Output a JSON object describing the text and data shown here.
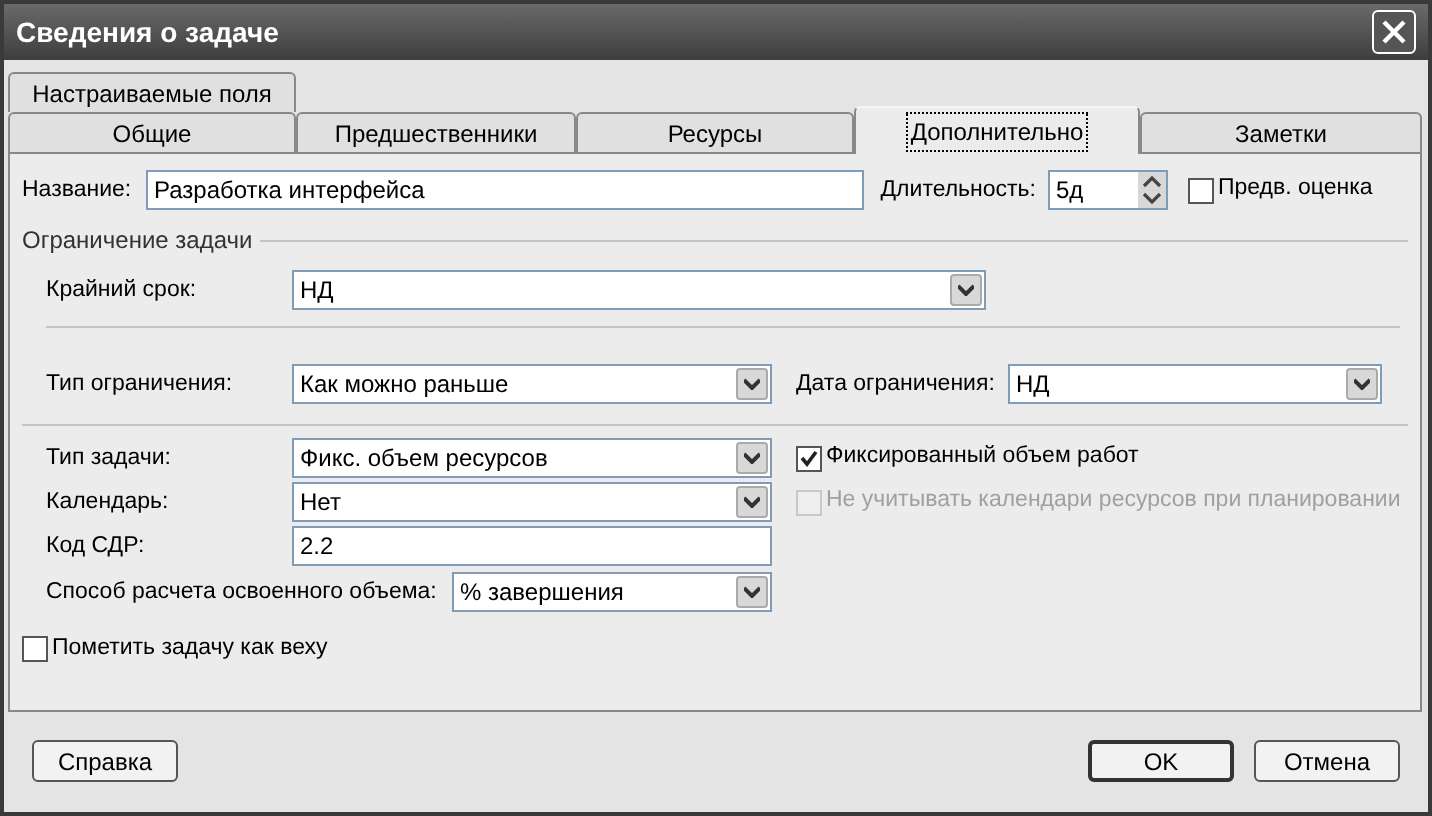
{
  "window": {
    "title": "Сведения о задаче"
  },
  "tab_rows": [
    [
      {
        "label": "Настраиваемые поля",
        "selected": false
      }
    ],
    [
      {
        "label": "Общие",
        "selected": false
      },
      {
        "label": "Предшественники",
        "selected": false
      },
      {
        "label": "Ресурсы",
        "selected": false
      },
      {
        "label": "Дополнительно",
        "selected": true
      },
      {
        "label": "Заметки",
        "selected": false
      }
    ]
  ],
  "name": {
    "label": "Название:",
    "value": "Разработка интерфейса"
  },
  "duration": {
    "label": "Длительность:",
    "value": "5д"
  },
  "estimate": {
    "label": "Предв. оценка",
    "checked": false,
    "disabled": false
  },
  "constraint_group": {
    "title": "Ограничение задачи",
    "deadline": {
      "label": "Крайний срок:",
      "value": "НД"
    },
    "constraint_type": {
      "label": "Тип ограничения:",
      "value": "Как можно раньше"
    },
    "constraint_date": {
      "label": "Дата ограничения:",
      "value": "НД"
    }
  },
  "task_type": {
    "label": "Тип задачи:",
    "value": "Фикс. объем ресурсов"
  },
  "effort_driven": {
    "label": "Фиксированный объем работ",
    "checked": true,
    "disabled": false
  },
  "calendar": {
    "label": "Календарь:",
    "value": "Нет"
  },
  "ignore_calendars": {
    "label": "Не учитывать календари ресурсов при планировании",
    "checked": false,
    "disabled": true
  },
  "wbs": {
    "label": "Код СДР:",
    "value": "2.2"
  },
  "earned_value": {
    "label": "Способ расчета освоенного объема:",
    "value": "% завершения"
  },
  "milestone": {
    "label": "Пометить задачу как веху",
    "checked": false,
    "disabled": false
  },
  "buttons": [
    {
      "label": "Справка",
      "default": false
    },
    {
      "label": "OK",
      "default": true
    },
    {
      "label": "Отмена",
      "default": false
    }
  ]
}
